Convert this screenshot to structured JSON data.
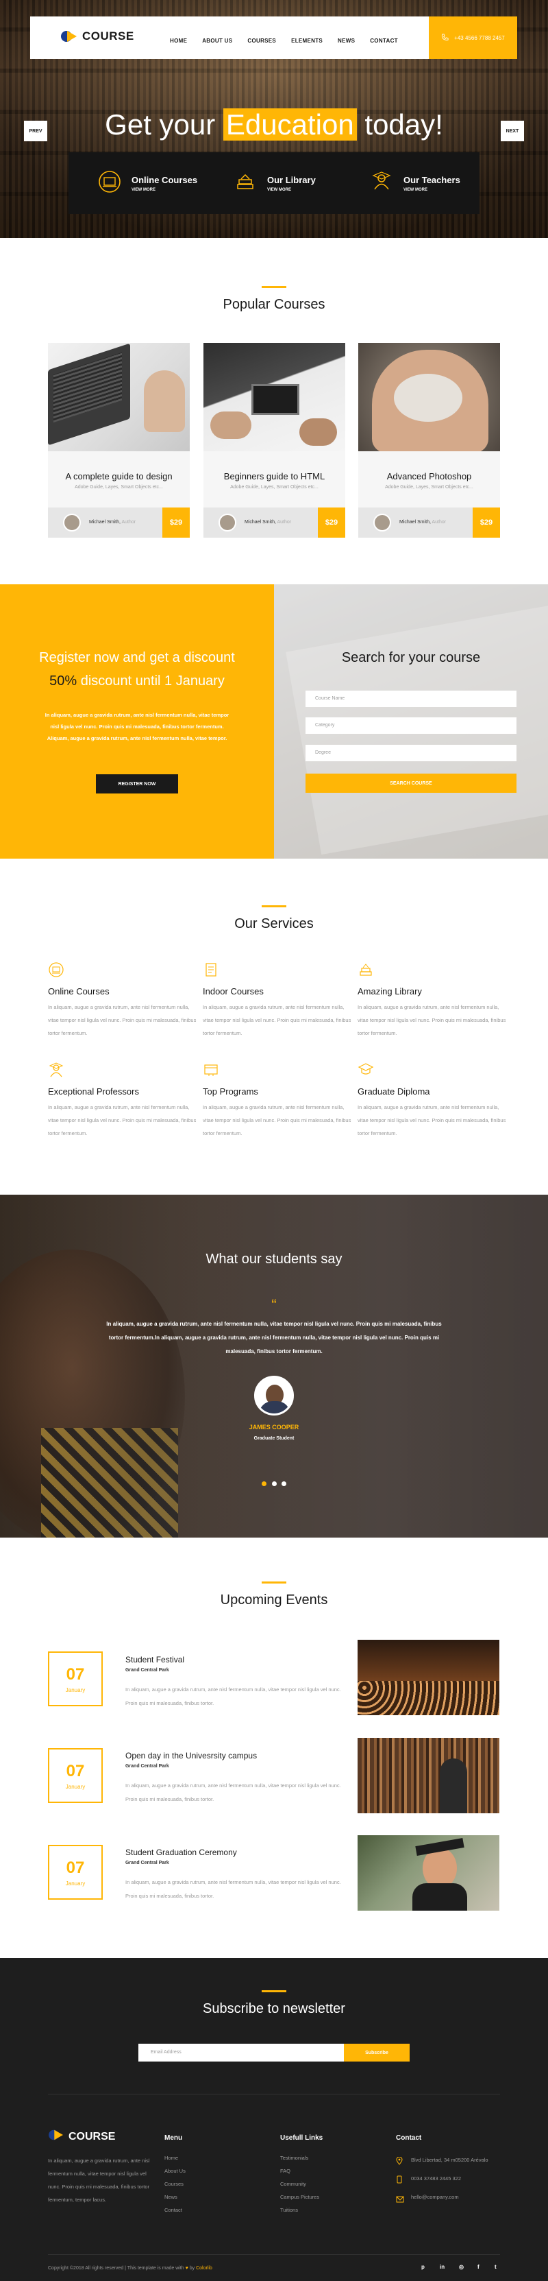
{
  "brand": {
    "name": "COURSE",
    "accent": "#ffb606"
  },
  "nav": {
    "items": [
      "HOME",
      "ABOUT US",
      "COURSES",
      "ELEMENTS",
      "NEWS",
      "CONTACT"
    ],
    "phone": "+43 4566 7788 2457"
  },
  "hero": {
    "prev": "PREV",
    "next": "NEXT",
    "title_before": "Get your",
    "title_highlight": "Education",
    "title_after": "today!",
    "features": [
      {
        "title": "Online Courses",
        "more": "VIEW MORE",
        "icon": "computer-icon"
      },
      {
        "title": "Our Library",
        "more": "VIEW MORE",
        "icon": "books-icon"
      },
      {
        "title": "Our Teachers",
        "more": "VIEW MORE",
        "icon": "teacher-icon"
      }
    ]
  },
  "popular": {
    "title": "Popular Courses",
    "courses": [
      {
        "title": "A complete guide to design",
        "sub": "Adobe Guide, Layes, Smart Objects etc...",
        "author": "Michael Smith,",
        "role": "Author",
        "price": "$29"
      },
      {
        "title": "Beginners guide to HTML",
        "sub": "Adobe Guide, Layes, Smart Objects etc...",
        "author": "Michael Smith,",
        "role": "Author",
        "price": "$29"
      },
      {
        "title": "Advanced Photoshop",
        "sub": "Adobe Guide, Layes, Smart Objects etc...",
        "author": "Michael Smith,",
        "role": "Author",
        "price": "$29"
      }
    ]
  },
  "register": {
    "line1": "Register now and get a discount",
    "pct": "50%",
    "line2": "discount until 1 January",
    "text": "In aliquam, augue a gravida rutrum, ante nisl fermentum nulla, vitae tempor nisl ligula vel nunc. Proin quis mi malesuada, finibus tortor fermentum. Aliquam, augue a gravida rutrum, ante nisl fermentum nulla, vitae tempor.",
    "button": "REGISTER NOW"
  },
  "search": {
    "title": "Search for your course",
    "fields": [
      "Course Name",
      "Category",
      "Degree"
    ],
    "button": "SEARCH COURSE"
  },
  "services": {
    "title": "Our Services",
    "items": [
      {
        "title": "Online Courses",
        "icon": "online-icon",
        "text": "In aliquam, augue a gravida rutrum, ante nisl fermentum nulla, vitae tempor nisl ligula vel nunc. Proin quis mi malesuada, finibus tortor fermentum."
      },
      {
        "title": "Indoor Courses",
        "icon": "indoor-icon",
        "text": "In aliquam, augue a gravida rutrum, ante nisl fermentum nulla, vitae tempor nisl ligula vel nunc. Proin quis mi malesuada, finibus tortor fermentum."
      },
      {
        "title": "Amazing Library",
        "icon": "library-icon",
        "text": "In aliquam, augue a gravida rutrum, ante nisl fermentum nulla, vitae tempor nisl ligula vel nunc. Proin quis mi malesuada, finibus tortor fermentum."
      },
      {
        "title": "Exceptional Professors",
        "icon": "professor-icon",
        "text": "In aliquam, augue a gravida rutrum, ante nisl fermentum nulla, vitae tempor nisl ligula vel nunc. Proin quis mi malesuada, finibus tortor fermentum."
      },
      {
        "title": "Top Programs",
        "icon": "programs-icon",
        "text": "In aliquam, augue a gravida rutrum, ante nisl fermentum nulla, vitae tempor nisl ligula vel nunc. Proin quis mi malesuada, finibus tortor fermentum."
      },
      {
        "title": "Graduate Diploma",
        "icon": "diploma-icon",
        "text": "In aliquam, augue a gravida rutrum, ante nisl fermentum nulla, vitae tempor nisl ligula vel nunc. Proin quis mi malesuada, finibus tortor fermentum."
      }
    ]
  },
  "testimonial": {
    "title": "What our students say",
    "quote_mark": "“",
    "text": "In aliquam, augue a gravida rutrum, ante nisl fermentum nulla, vitae tempor nisl ligula vel nunc. Proin quis mi malesuada, finibus tortor fermentum.In aliquam, augue a gravida rutrum, ante nisl fermentum nulla, vitae tempor nisl ligula vel nunc. Proin quis mi malesuada, finibus tortor fermentum.",
    "name": "JAMES COOPER",
    "role": "Graduate Student"
  },
  "events": {
    "title": "Upcoming Events",
    "items": [
      {
        "day": "07",
        "month": "January",
        "title": "Student Festival",
        "location": "Grand Central Park",
        "text": "In aliquam, augue a gravida rutrum, ante nisl fermentum nulla, vitae tempor nisl ligula vel nunc. Proin quis mi malesuada, finibus tortor."
      },
      {
        "day": "07",
        "month": "January",
        "title": "Open day in the Univesrsity campus",
        "location": "Grand Central Park",
        "text": "In aliquam, augue a gravida rutrum, ante nisl fermentum nulla, vitae tempor nisl ligula vel nunc. Proin quis mi malesuada, finibus tortor."
      },
      {
        "day": "07",
        "month": "January",
        "title": "Student Graduation Ceremony",
        "location": "Grand Central Park",
        "text": "In aliquam, augue a gravida rutrum, ante nisl fermentum nulla, vitae tempor nisl ligula vel nunc. Proin quis mi malesuada, finibus tortor."
      }
    ]
  },
  "newsletter": {
    "title": "Subscribe to newsletter",
    "placeholder": "Email Address",
    "button": "Subscribe"
  },
  "footer": {
    "about": "In aliquam, augue a gravida rutrum, ante nisl fermentum nulla, vitae tempor nisl ligula vel nunc. Proin quis mi malesuada, finibus tortor fermentum, tempor lacus.",
    "menu_title": "Menu",
    "menu": [
      "Home",
      "About Us",
      "Courses",
      "News",
      "Contact"
    ],
    "links_title": "Usefull Links",
    "links": [
      "Testimonials",
      "FAQ",
      "Community",
      "Campus Pictures",
      "Tuitions"
    ],
    "contact_title": "Contact",
    "address": "Blvd Libertad, 34 m05200 Arévalo",
    "phone": "0034 37483 2445 322",
    "email": "hello@company.com",
    "copyright": "Copyright ©2018 All rights reserved | This template is made with",
    "by": "by",
    "credit": "Colorlib",
    "social": [
      "p",
      "in",
      "◎",
      "f",
      "t"
    ]
  }
}
